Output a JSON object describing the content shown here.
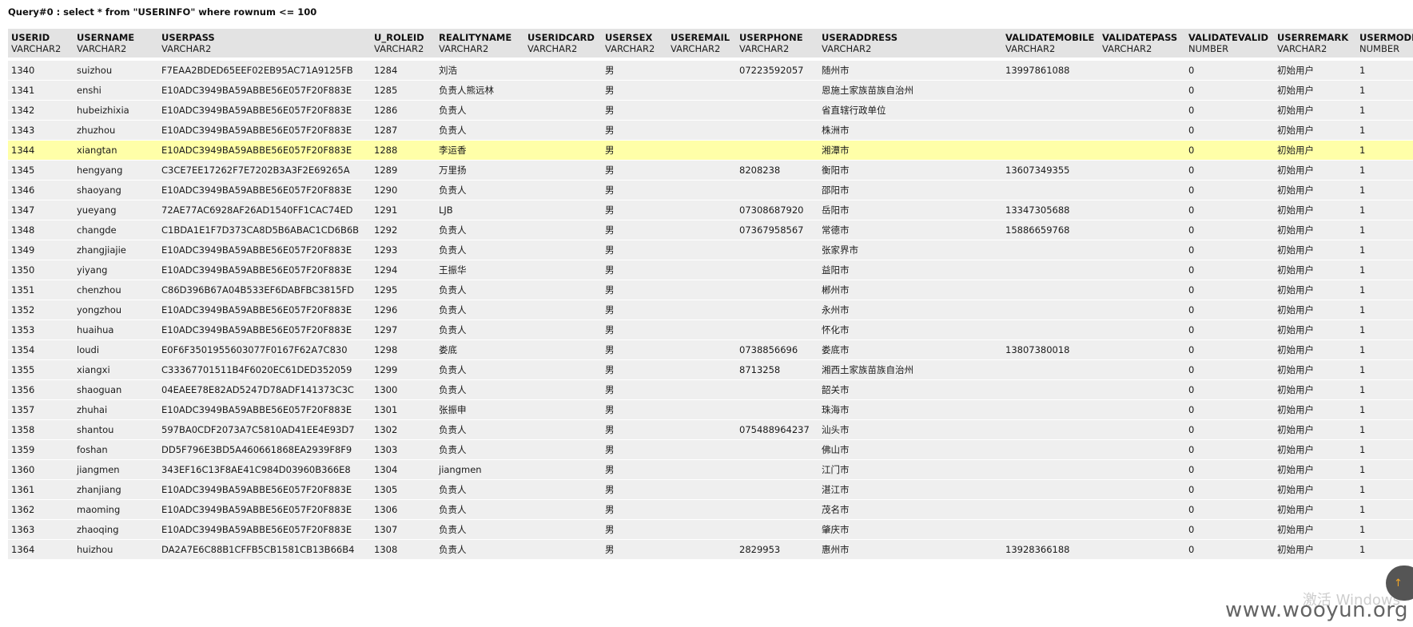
{
  "query": {
    "title": "Query#0 : select * from \"USERINFO\" where rownum <= 100"
  },
  "columns": [
    {
      "name": "USERID",
      "type": "VARCHAR2"
    },
    {
      "name": "USERNAME",
      "type": "VARCHAR2"
    },
    {
      "name": "USERPASS",
      "type": "VARCHAR2"
    },
    {
      "name": "U_ROLEID",
      "type": "VARCHAR2"
    },
    {
      "name": "REALITYNAME",
      "type": "VARCHAR2"
    },
    {
      "name": "USERIDCARD",
      "type": "VARCHAR2"
    },
    {
      "name": "USERSEX",
      "type": "VARCHAR2"
    },
    {
      "name": "USEREMAIL",
      "type": "VARCHAR2"
    },
    {
      "name": "USERPHONE",
      "type": "VARCHAR2"
    },
    {
      "name": "USERADDRESS",
      "type": "VARCHAR2"
    },
    {
      "name": "VALIDATEMOBILE",
      "type": "VARCHAR2"
    },
    {
      "name": "VALIDATEPASS",
      "type": "VARCHAR2"
    },
    {
      "name": "VALIDATEVALID",
      "type": "NUMBER"
    },
    {
      "name": "USERREMARK",
      "type": "VARCHAR2"
    },
    {
      "name": "USERMODE",
      "type": "NUMBER"
    }
  ],
  "rows": [
    [
      "1340",
      "suizhou",
      "F7EAA2BDED65EEF02EB95AC71A9125FB",
      "1284",
      "刘浩",
      "",
      "男",
      "",
      "07223592057",
      "随州市",
      "13997861088",
      "",
      "0",
      "初始用户",
      "1"
    ],
    [
      "1341",
      "enshi",
      "E10ADC3949BA59ABBE56E057F20F883E",
      "1285",
      "负责人熊远林",
      "",
      "男",
      "",
      "",
      "恩施土家族苗族自治州",
      "",
      "",
      "0",
      "初始用户",
      "1"
    ],
    [
      "1342",
      "hubeizhixia",
      "E10ADC3949BA59ABBE56E057F20F883E",
      "1286",
      "负责人",
      "",
      "男",
      "",
      "",
      "省直辖行政单位",
      "",
      "",
      "0",
      "初始用户",
      "1"
    ],
    [
      "1343",
      "zhuzhou",
      "E10ADC3949BA59ABBE56E057F20F883E",
      "1287",
      "负责人",
      "",
      "男",
      "",
      "",
      "株洲市",
      "",
      "",
      "0",
      "初始用户",
      "1"
    ],
    [
      "1344",
      "xiangtan",
      "E10ADC3949BA59ABBE56E057F20F883E",
      "1288",
      "李运香",
      "",
      "男",
      "",
      "",
      "湘潭市",
      "",
      "",
      "0",
      "初始用户",
      "1"
    ],
    [
      "1345",
      "hengyang",
      "C3CE7EE17262F7E7202B3A3F2E69265A",
      "1289",
      "万里扬",
      "",
      "男",
      "",
      "8208238",
      "衡阳市",
      "13607349355",
      "",
      "0",
      "初始用户",
      "1"
    ],
    [
      "1346",
      "shaoyang",
      "E10ADC3949BA59ABBE56E057F20F883E",
      "1290",
      "负责人",
      "",
      "男",
      "",
      "",
      "邵阳市",
      "",
      "",
      "0",
      "初始用户",
      "1"
    ],
    [
      "1347",
      "yueyang",
      "72AE77AC6928AF26AD1540FF1CAC74ED",
      "1291",
      "LJB",
      "",
      "男",
      "",
      "07308687920",
      "岳阳市",
      "13347305688",
      "",
      "0",
      "初始用户",
      "1"
    ],
    [
      "1348",
      "changde",
      "C1BDA1E1F7D373CA8D5B6ABAC1CD6B6B",
      "1292",
      "负责人",
      "",
      "男",
      "",
      "07367958567",
      "常德市",
      "15886659768",
      "",
      "0",
      "初始用户",
      "1"
    ],
    [
      "1349",
      "zhangjiajie",
      "E10ADC3949BA59ABBE56E057F20F883E",
      "1293",
      "负责人",
      "",
      "男",
      "",
      "",
      "张家界市",
      "",
      "",
      "0",
      "初始用户",
      "1"
    ],
    [
      "1350",
      "yiyang",
      "E10ADC3949BA59ABBE56E057F20F883E",
      "1294",
      "王振华",
      "",
      "男",
      "",
      "",
      "益阳市",
      "",
      "",
      "0",
      "初始用户",
      "1"
    ],
    [
      "1351",
      "chenzhou",
      "C86D396B67A04B533EF6DABFBC3815FD",
      "1295",
      "负责人",
      "",
      "男",
      "",
      "",
      "郴州市",
      "",
      "",
      "0",
      "初始用户",
      "1"
    ],
    [
      "1352",
      "yongzhou",
      "E10ADC3949BA59ABBE56E057F20F883E",
      "1296",
      "负责人",
      "",
      "男",
      "",
      "",
      "永州市",
      "",
      "",
      "0",
      "初始用户",
      "1"
    ],
    [
      "1353",
      "huaihua",
      "E10ADC3949BA59ABBE56E057F20F883E",
      "1297",
      "负责人",
      "",
      "男",
      "",
      "",
      "怀化市",
      "",
      "",
      "0",
      "初始用户",
      "1"
    ],
    [
      "1354",
      "loudi",
      "E0F6F3501955603077F0167F62A7C830",
      "1298",
      "娄底",
      "",
      "男",
      "",
      "0738856696",
      "娄底市",
      "13807380018",
      "",
      "0",
      "初始用户",
      "1"
    ],
    [
      "1355",
      "xiangxi",
      "C33367701511B4F6020EC61DED352059",
      "1299",
      "负责人",
      "",
      "男",
      "",
      "8713258",
      "湘西土家族苗族自治州",
      "",
      "",
      "0",
      "初始用户",
      "1"
    ],
    [
      "1356",
      "shaoguan",
      "04EAEE78E82AD5247D78ADF141373C3C",
      "1300",
      "负责人",
      "",
      "男",
      "",
      "",
      "韶关市",
      "",
      "",
      "0",
      "初始用户",
      "1"
    ],
    [
      "1357",
      "zhuhai",
      "E10ADC3949BA59ABBE56E057F20F883E",
      "1301",
      "张振申",
      "",
      "男",
      "",
      "",
      "珠海市",
      "",
      "",
      "0",
      "初始用户",
      "1"
    ],
    [
      "1358",
      "shantou",
      "597BA0CDF2073A7C5810AD41EE4E93D7",
      "1302",
      "负责人",
      "",
      "男",
      "",
      "075488964237",
      "汕头市",
      "",
      "",
      "0",
      "初始用户",
      "1"
    ],
    [
      "1359",
      "foshan",
      "DD5F796E3BD5A460661868EA2939F8F9",
      "1303",
      "负责人",
      "",
      "男",
      "",
      "",
      "佛山市",
      "",
      "",
      "0",
      "初始用户",
      "1"
    ],
    [
      "1360",
      "jiangmen",
      "343EF16C13F8AE41C984D03960B366E8",
      "1304",
      "jiangmen",
      "",
      "男",
      "",
      "",
      "江门市",
      "",
      "",
      "0",
      "初始用户",
      "1"
    ],
    [
      "1361",
      "zhanjiang",
      "E10ADC3949BA59ABBE56E057F20F883E",
      "1305",
      "负责人",
      "",
      "男",
      "",
      "",
      "湛江市",
      "",
      "",
      "0",
      "初始用户",
      "1"
    ],
    [
      "1362",
      "maoming",
      "E10ADC3949BA59ABBE56E057F20F883E",
      "1306",
      "负责人",
      "",
      "男",
      "",
      "",
      "茂名市",
      "",
      "",
      "0",
      "初始用户",
      "1"
    ],
    [
      "1363",
      "zhaoqing",
      "E10ADC3949BA59ABBE56E057F20F883E",
      "1307",
      "负责人",
      "",
      "男",
      "",
      "",
      "肇庆市",
      "",
      "",
      "0",
      "初始用户",
      "1"
    ],
    [
      "1364",
      "huizhou",
      "DA2A7E6C88B1CFFB5CB1581CB13B66B4",
      "1308",
      "负责人",
      "",
      "男",
      "",
      "2829953",
      "惠州市",
      "13928366188",
      "",
      "0",
      "初始用户",
      "1"
    ]
  ],
  "highlighted_row_index": 4,
  "colors": {
    "header_bg": "#e3e3e3",
    "row_bg": "#efefef",
    "highlight_bg": "#ffffa8"
  },
  "watermark": {
    "site": "www.wooyun.org",
    "windows_text": "激活 Windows"
  },
  "float_button": {
    "icon": "arrow-up-icon"
  }
}
